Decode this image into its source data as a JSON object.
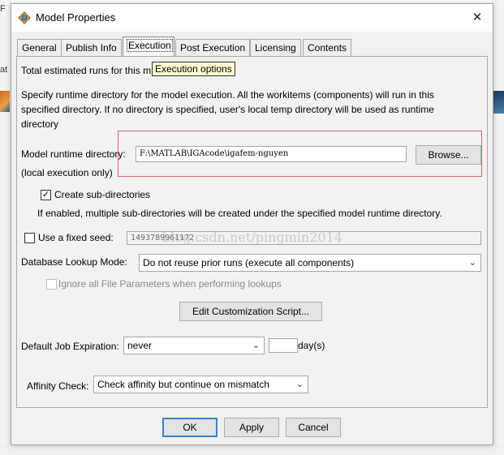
{
  "background": {
    "top_text": "F",
    "mid_text": "at"
  },
  "window": {
    "title": "Model Properties",
    "close_glyph": "✕"
  },
  "tabs": [
    {
      "label": "General",
      "active": false
    },
    {
      "label": "Publish Info",
      "active": false
    },
    {
      "label": "Execution",
      "active": true
    },
    {
      "label": "Post Execution",
      "active": false
    },
    {
      "label": "Licensing",
      "active": false
    },
    {
      "label": "Contents",
      "active": false
    }
  ],
  "tooltip": "Execution options",
  "execution": {
    "estimated_runs_label": "Total estimated runs for this m",
    "description_lines": [
      "Specify runtime directory for the model execution. All the workitems (components) will run in this",
      "specified directory. If no directory is specified, user's local temp directory will be used as runtime",
      "directory"
    ],
    "runtime_dir_label": "Model runtime directory:",
    "runtime_dir_sublabel": "(local execution only)",
    "runtime_dir_value": "F:\\MATLAB\\IGAcode\\igafem-nguyen",
    "browse_label": "Browse...",
    "create_subdirs_label": "Create sub-directories",
    "create_subdirs_checked": true,
    "subdirs_note": "If enabled, multiple sub-directories will be created under the specified model runtime directory.",
    "fixed_seed_label": "Use a fixed seed:",
    "fixed_seed_checked": false,
    "seed_value": "1493789961172",
    "watermark": "blog.csdn.net/pingmin2014",
    "lookup_label": "Database Lookup Mode:",
    "lookup_value": "Do not reuse prior runs (execute all components)",
    "ignore_params_label": "Ignore all File Parameters when performing lookups",
    "ignore_params_checked": false,
    "edit_script_label": "Edit Customization Script...",
    "expiration_label": "Default Job Expiration:",
    "expiration_value": "never",
    "days_value": "",
    "days_unit": "day(s)",
    "affinity_label": "Affinity Check:",
    "affinity_value": "Check affinity but continue on mismatch"
  },
  "footer": {
    "ok_label": "OK",
    "apply_label": "Apply",
    "cancel_label": "Cancel"
  },
  "colors": {
    "highlight_box": "#e06060",
    "default_button_border": "#3c7fd1",
    "tooltip_bg": "#fffbd2"
  }
}
